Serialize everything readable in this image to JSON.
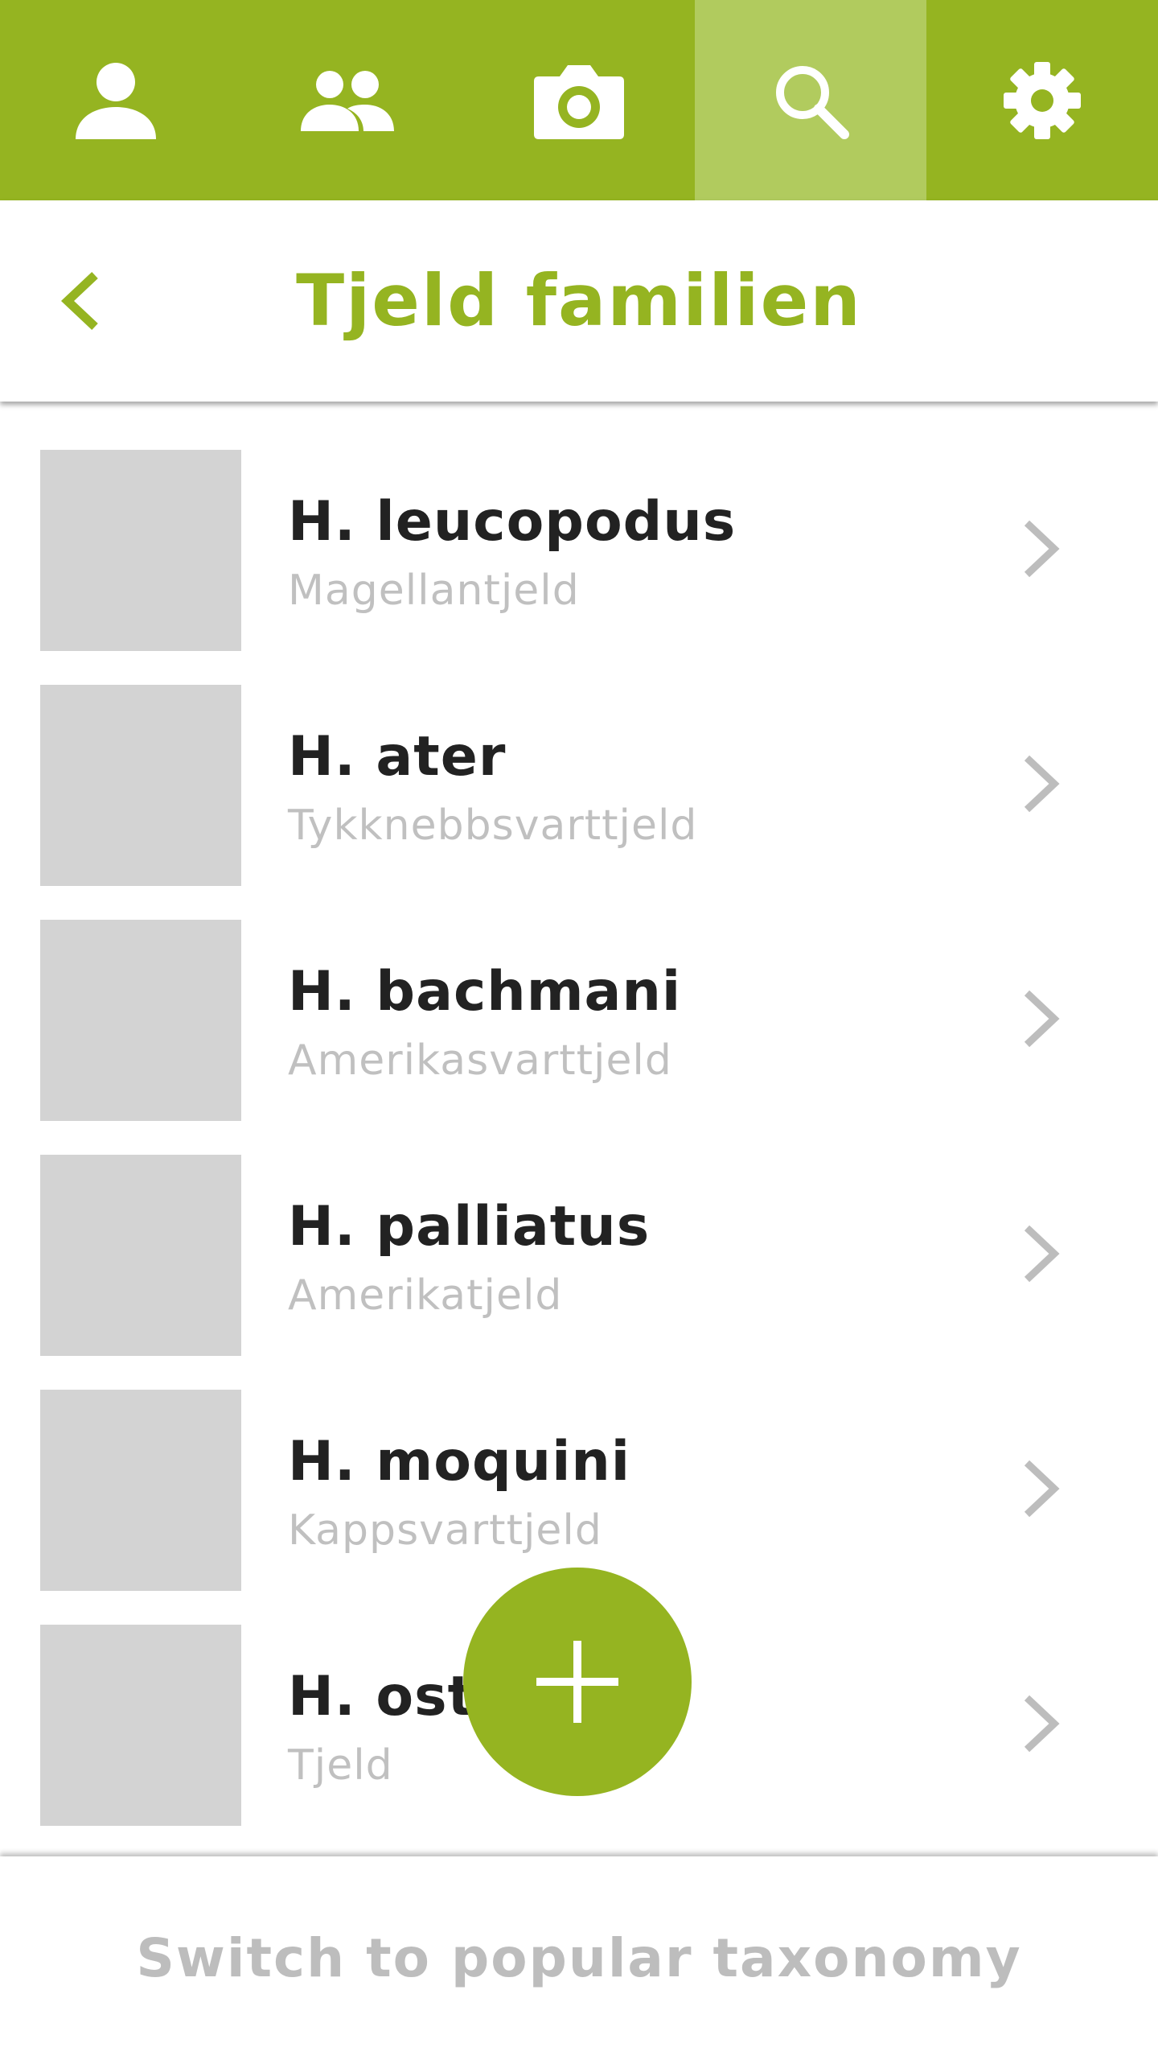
{
  "nav": {
    "tabs": [
      {
        "icon": "person-icon"
      },
      {
        "icon": "group-icon"
      },
      {
        "icon": "camera-icon"
      },
      {
        "icon": "search-icon",
        "active": true
      },
      {
        "icon": "gear-icon"
      }
    ]
  },
  "header": {
    "title": "Tjeld familien"
  },
  "list": {
    "items": [
      {
        "scientific": "H. leucopodus",
        "common": "Magellantjeld"
      },
      {
        "scientific": "H. ater",
        "common": "Tykknebbsvarttjeld"
      },
      {
        "scientific": "H. bachmani",
        "common": "Amerikasvarttjeld"
      },
      {
        "scientific": "H. palliatus",
        "common": "Amerikatjeld"
      },
      {
        "scientific": "H. moquini",
        "common": "Kappsvarttjeld"
      },
      {
        "scientific": "H. ostr",
        "common": "Tjeld"
      }
    ]
  },
  "fab": {
    "icon": "plus-icon"
  },
  "footer": {
    "switch_label": "Switch to popular taxonomy"
  },
  "colors": {
    "brand": "#95b421",
    "active_tab": "#b1cb5e",
    "thumb_placeholder": "#d3d3d3",
    "secondary_text": "#c0c0c0"
  }
}
